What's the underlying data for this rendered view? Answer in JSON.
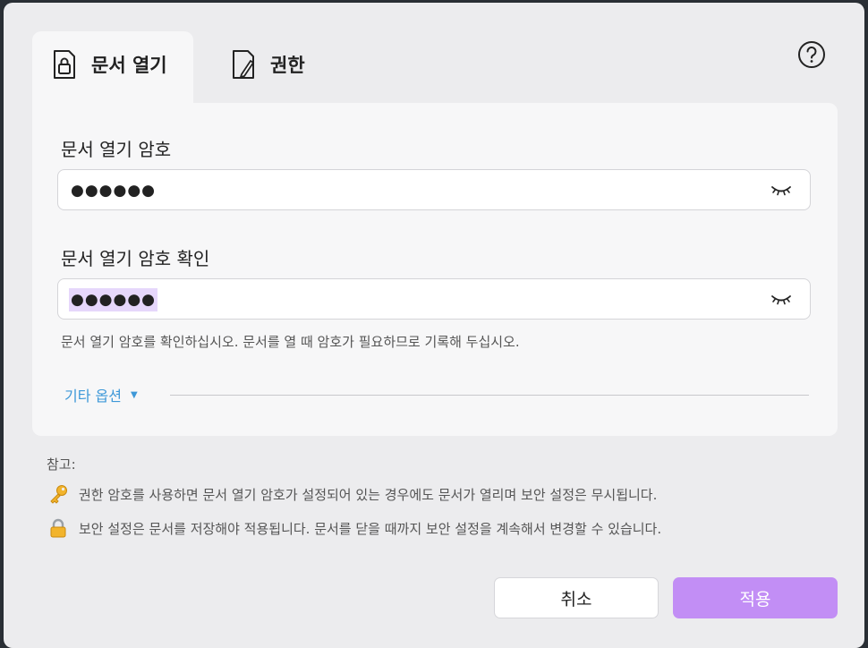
{
  "tabs": [
    {
      "label": "문서 열기",
      "icon": "lock-document-icon",
      "active": true
    },
    {
      "label": "권한",
      "icon": "edit-document-icon",
      "active": false
    }
  ],
  "help_icon": "help-icon",
  "open_password": {
    "label": "문서 열기 암호",
    "value": "●●●●●●",
    "toggle_icon": "eye-closed-icon"
  },
  "confirm_password": {
    "label": "문서 열기 암호 확인",
    "value": "●●●●●●",
    "toggle_icon": "eye-closed-icon",
    "hint": "문서 열기 암호를 확인하십시오. 문서를 열 때 암호가 필요하므로 기록해 두십시오."
  },
  "more_options": {
    "label": "기타 옵션",
    "caret": "▼"
  },
  "notes": {
    "title": "참고:",
    "items": [
      {
        "icon": "key-icon",
        "text": "권한 암호를 사용하면 문서 열기 암호가 설정되어 있는 경우에도 문서가 열리며 보안 설정은 무시됩니다."
      },
      {
        "icon": "lock-icon",
        "text": "보안 설정은 문서를 저장해야 적용됩니다. 문서를 닫을 때까지 보안 설정을 계속해서 변경할 수 있습니다."
      }
    ]
  },
  "buttons": {
    "cancel": "취소",
    "apply": "적용"
  },
  "colors": {
    "accent": "#c28ef5",
    "link": "#3d98d8",
    "selection": "#e6d7fb"
  }
}
